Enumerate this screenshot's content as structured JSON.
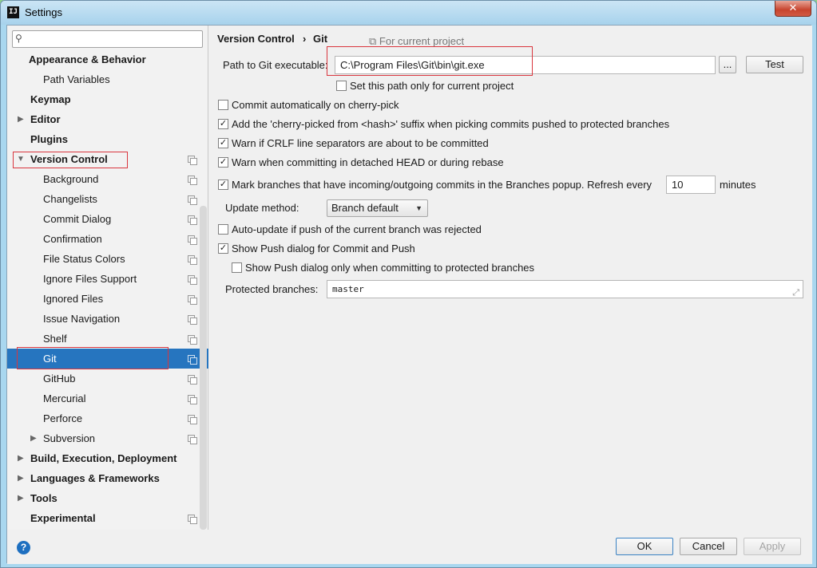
{
  "window": {
    "title": "Settings",
    "app_icon": "IJ",
    "close_glyph": "✕"
  },
  "sidebar": {
    "search_placeholder": "",
    "items": [
      {
        "label": "Appearance & Behavior"
      },
      {
        "label": "Path Variables"
      },
      {
        "label": "Keymap"
      },
      {
        "label": "Editor"
      },
      {
        "label": "Plugins"
      },
      {
        "label": "Version Control"
      },
      {
        "label": "Background"
      },
      {
        "label": "Changelists"
      },
      {
        "label": "Commit Dialog"
      },
      {
        "label": "Confirmation"
      },
      {
        "label": "File Status Colors"
      },
      {
        "label": "Ignore Files Support"
      },
      {
        "label": "Ignored Files"
      },
      {
        "label": "Issue Navigation"
      },
      {
        "label": "Shelf"
      },
      {
        "label": "Git"
      },
      {
        "label": "GitHub"
      },
      {
        "label": "Mercurial"
      },
      {
        "label": "Perforce"
      },
      {
        "label": "Subversion"
      },
      {
        "label": "Build, Execution, Deployment"
      },
      {
        "label": "Languages & Frameworks"
      },
      {
        "label": "Tools"
      },
      {
        "label": "Experimental"
      }
    ]
  },
  "breadcrumb": {
    "parent": "Version Control",
    "separator": "›",
    "current": "Git",
    "scope": "For current project"
  },
  "git": {
    "path_label": "Path to Git executable:",
    "path_value": "C:\\Program Files\\Git\\bin\\git.exe",
    "browse_label": "...",
    "test_label": "Test",
    "path_only_project": "Set this path only for current project",
    "cherry_pick_auto": "Commit automatically on cherry-pick",
    "cherry_pick_suffix": "Add the 'cherry-picked from <hash>' suffix when picking commits pushed to protected branches",
    "warn_crlf": "Warn if CRLF line separators are about to be committed",
    "warn_detached": "Warn when committing in detached HEAD or during rebase",
    "mark_branches": "Mark branches that have incoming/outgoing commits in the Branches popup.  Refresh every",
    "refresh_value": "10",
    "minutes": "minutes",
    "update_method_label": "Update method:",
    "update_method_value": "Branch default",
    "auto_update": "Auto-update if push of the current branch was rejected",
    "show_push": "Show Push dialog for Commit and Push",
    "show_push_protected": "Show Push dialog only when committing to protected branches",
    "protected_label": "Protected branches:",
    "protected_value": "master"
  },
  "footer": {
    "help": "?",
    "ok": "OK",
    "cancel": "Cancel",
    "apply": "Apply"
  },
  "colors": {
    "selection": "#2675bf",
    "annotation_box": "#d9363e"
  }
}
